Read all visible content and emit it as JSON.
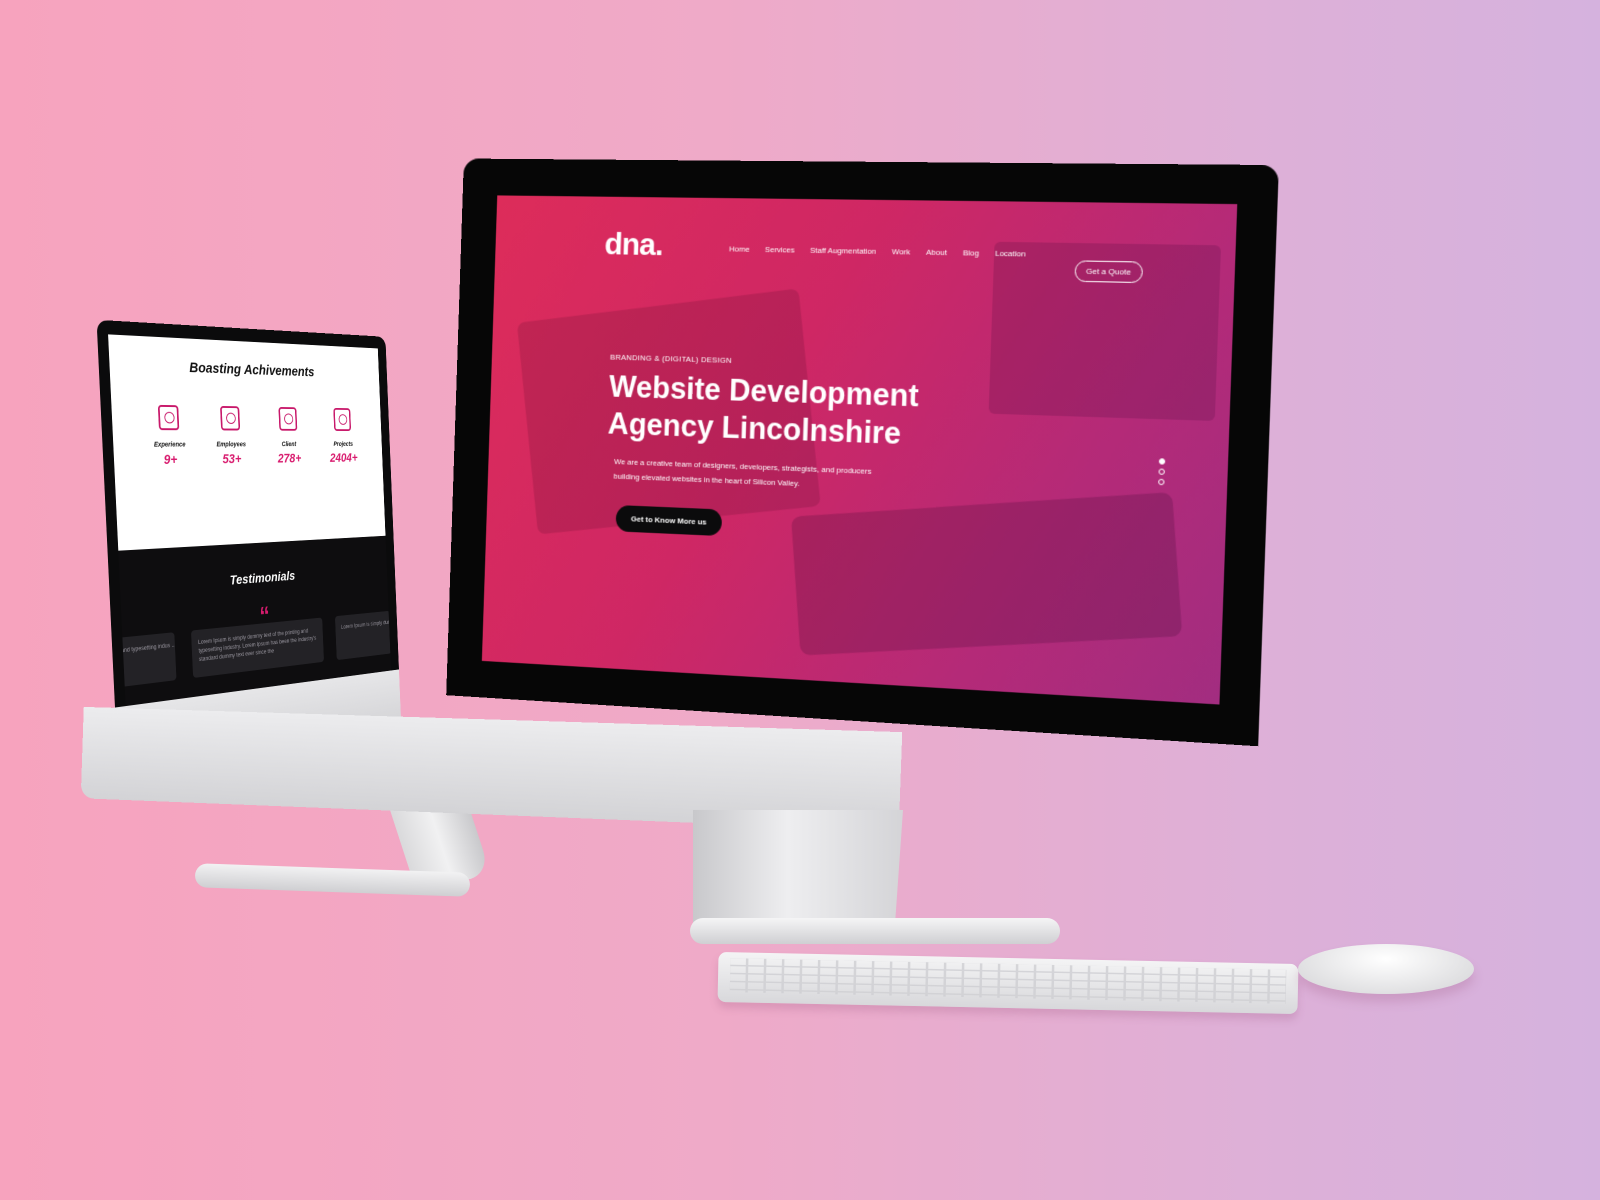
{
  "left_site": {
    "achievements_title": "Boasting Achivements",
    "stats": [
      {
        "icon": "award-icon",
        "label": "Experience",
        "value": "9+"
      },
      {
        "icon": "team-icon",
        "label": "Employees",
        "value": "53+"
      },
      {
        "icon": "client-icon",
        "label": "Client",
        "value": "278+"
      },
      {
        "icon": "document-icon",
        "label": "Projects",
        "value": "2404+"
      }
    ],
    "testimonials_title": "Testimonials",
    "quote_mark": "“",
    "cards": [
      "ing and typesetting indus ... sit simply lorem dummy text",
      "Lorem Ipsum is simply dummy text of the printing and typesetting industry. Lorem Ipsum has been the industry's standard dummy text ever since the",
      "Lorem Ipsum is simply dummy ... standard dummy text ever"
    ]
  },
  "main_site": {
    "logo": "dna.",
    "nav": [
      "Home",
      "Services",
      "Staff Augmentation",
      "Work",
      "About",
      "Blog",
      "Location"
    ],
    "quote_button": "Get a Quote",
    "kicker": "BRANDING & (DIGITAL) DESIGN",
    "hero_title": "Website Development Agency Lincolnshire",
    "hero_subtitle": "We are a creative team of designers, developers, strategists, and producers building elevated websites in the heart of Silicon Valley.",
    "cta_label": "Get to Know More us",
    "slider_dots": 3,
    "active_dot": 0
  },
  "colors": {
    "accent": "#d81b6e",
    "hero_start": "#dd2c5a",
    "hero_end": "#a22d80",
    "dark": "#0b0b0c"
  }
}
